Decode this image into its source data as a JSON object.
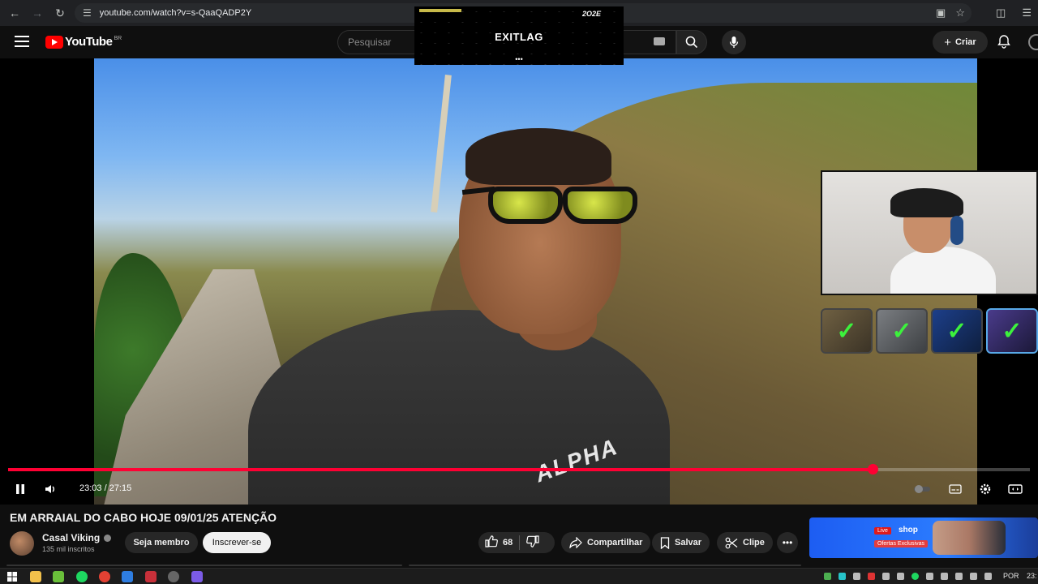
{
  "browser": {
    "url": "youtube.com/watch?v=s-QaaQADP2Y"
  },
  "header": {
    "logo_text": "YouTube",
    "country_code": "BR",
    "search_placeholder": "Pesquisar",
    "create_label": "Criar"
  },
  "ad_overlay": {
    "brand": "EXITLAG",
    "year": "2O2E",
    "dots": "•••"
  },
  "player": {
    "time_current": "23:03",
    "time_total": "27:15",
    "time_display": "23:03 / 27:15",
    "progress_fraction": 0.846,
    "shirt_text": "ALPHA",
    "accent_color": "#ff0033",
    "badges": [
      "✓",
      "✓",
      "✓",
      "✓"
    ]
  },
  "video": {
    "title": "EM ARRAIAL DO CABO HOJE 09/01/25 ATENÇÃO",
    "channel_name": "Casal Viking",
    "subscribers": "135 mil inscritos",
    "member_label": "Seja membro",
    "subscribe_label": "Inscrever-se",
    "likes": "68",
    "share_label": "Compartilhar",
    "save_label": "Salvar",
    "clip_label": "Clipe"
  },
  "side_ad": {
    "live_label": "Live",
    "shop_label": "shop",
    "offers_label": "Ofertas Exclusivas"
  },
  "taskbar": {
    "language": "POR",
    "clock": "23:"
  }
}
